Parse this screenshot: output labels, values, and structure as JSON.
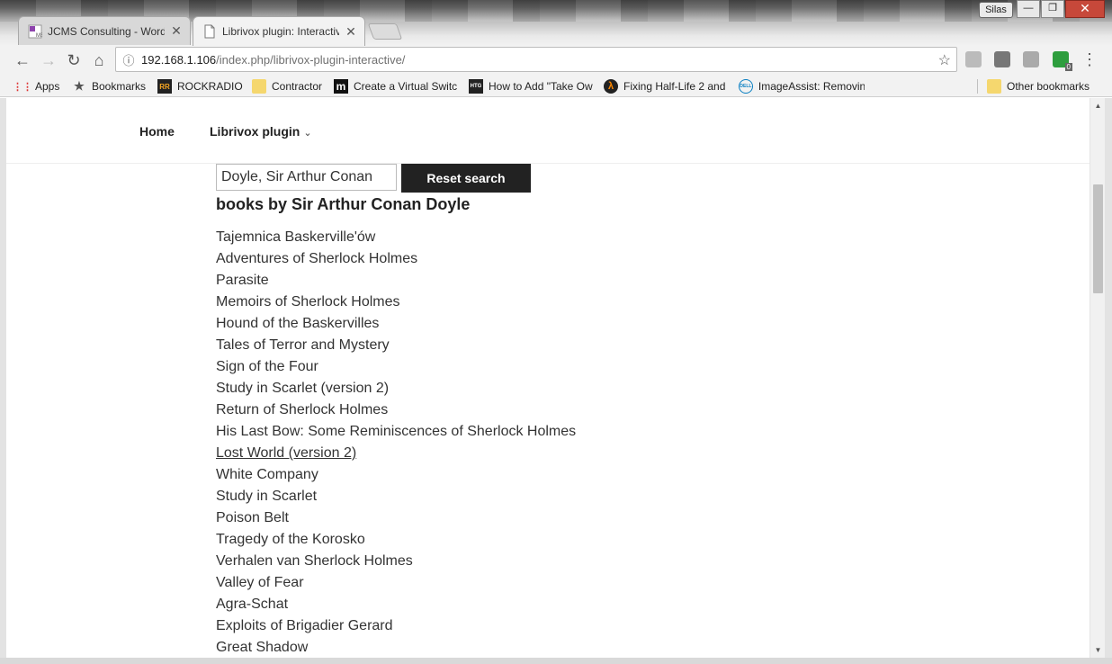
{
  "window": {
    "user_label": "Silas",
    "minimize_glyph": "—",
    "restore_glyph": "❐",
    "close_glyph": "✕"
  },
  "tabs": [
    {
      "title": "JCMS Consulting - Word",
      "favicon": "jcms-favicon",
      "close": "✕"
    },
    {
      "title": "Librivox plugin: Interactiv",
      "favicon": "page-icon",
      "close": "✕"
    }
  ],
  "toolbar": {
    "back_glyph": "←",
    "forward_glyph": "→",
    "reload_glyph": "↻",
    "home_glyph": "⌂",
    "info_glyph": "ⓘ",
    "url_host": "192.168.1.106",
    "url_path": "/index.php/librivox-plugin-interactive/",
    "star_glyph": "☆",
    "ext_badge": "0",
    "menu_glyph": "⋮"
  },
  "bookmarks": [
    {
      "label": "Apps",
      "icon": "apps-grid-icon",
      "glyph": "⋮⋮"
    },
    {
      "label": "Bookmarks",
      "icon": "star-icon",
      "glyph": "★"
    },
    {
      "label": "ROCKRADIO",
      "icon": "rockradio-icon",
      "glyph": "RR"
    },
    {
      "label": "Contractor",
      "icon": "folder-icon",
      "glyph": ""
    },
    {
      "label": "Create a Virtual Switc",
      "icon": "m-icon",
      "glyph": "m"
    },
    {
      "label": "How to Add \"Take Ow",
      "icon": "htg-icon",
      "glyph": "HTG"
    },
    {
      "label": "Fixing Half-Life 2 and",
      "icon": "lambda-icon",
      "glyph": "λ"
    },
    {
      "label": "ImageAssist: Removin",
      "icon": "dell-icon",
      "glyph": "DELL"
    },
    {
      "label": "Other bookmarks",
      "icon": "folder-icon",
      "glyph": ""
    }
  ],
  "site_nav": {
    "home": "Home",
    "librivox": "Librivox plugin",
    "chevron": "⌄"
  },
  "search": {
    "value": "Doyle, Sir Arthur Conan",
    "reset_label": "Reset search"
  },
  "heading": "books by Sir Arthur Conan Doyle",
  "books": [
    "Tajemnica Baskerville'ów",
    "Adventures of Sherlock Holmes",
    "Parasite",
    "Memoirs of Sherlock Holmes",
    "Hound of the Baskervilles",
    "Tales of Terror and Mystery",
    "Sign of the Four",
    "Study in Scarlet (version 2)",
    "Return of Sherlock Holmes",
    "His Last Bow: Some Reminiscences of Sherlock Holmes",
    "Lost World (version 2)",
    "White Company",
    "Study in Scarlet",
    "Poison Belt",
    "Tragedy of the Korosko",
    "Verhalen van Sherlock Holmes",
    "Valley of Fear",
    "Agra-Schat",
    "Exploits of Brigadier Gerard",
    "Great Shadow"
  ],
  "hovered_book_index": 10,
  "scrollbar": {
    "up_glyph": "▲",
    "down_glyph": "▼"
  },
  "colors": {
    "button_bg": "#222222",
    "text": "#333333"
  }
}
